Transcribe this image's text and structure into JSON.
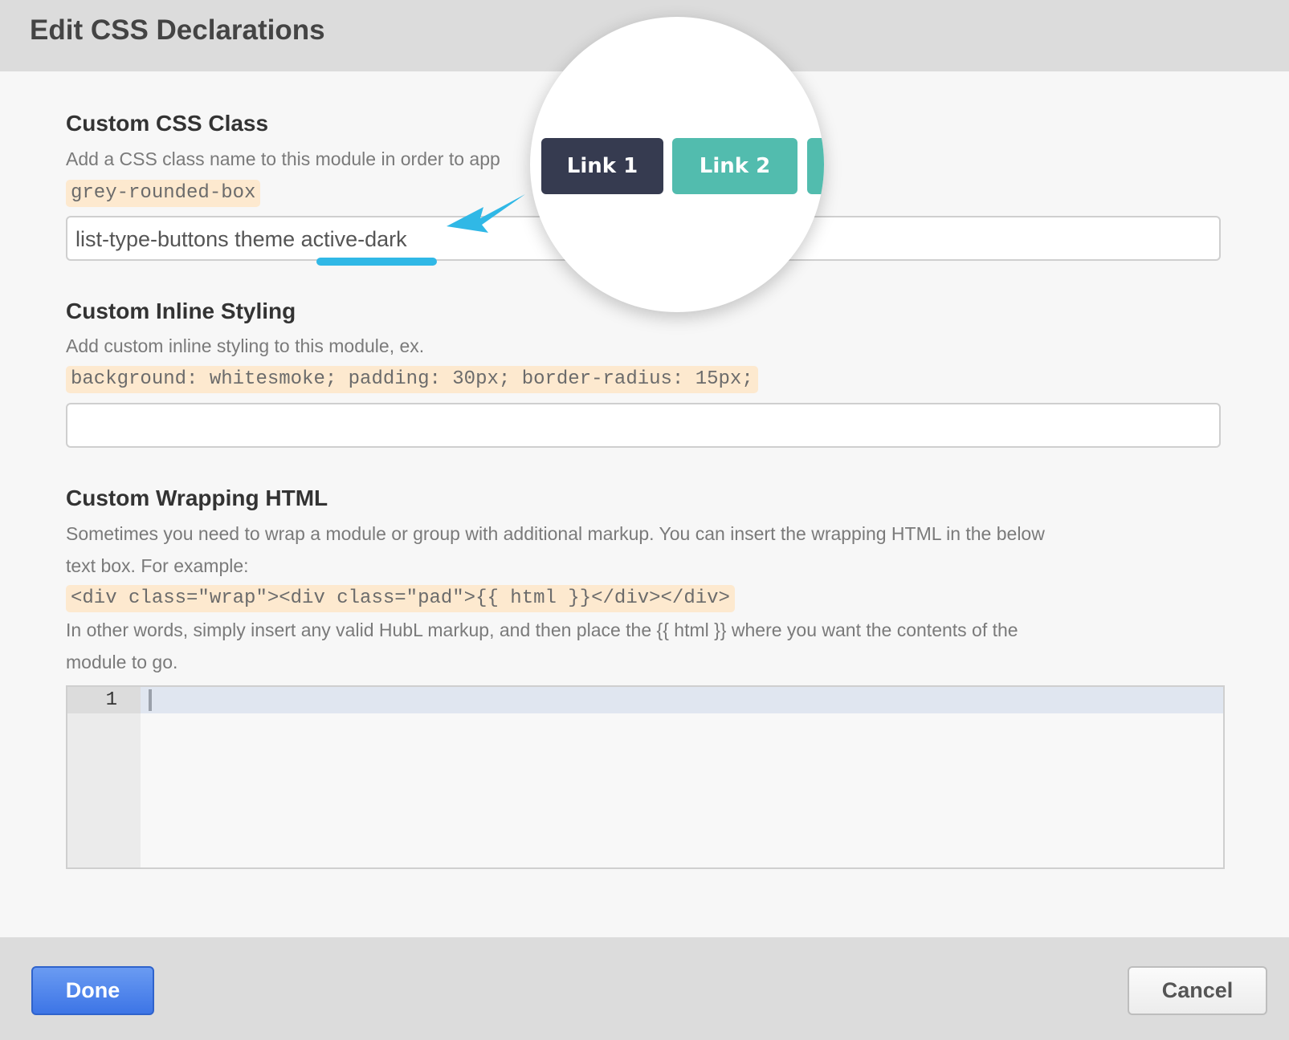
{
  "dialog": {
    "title": "Edit CSS Declarations"
  },
  "css_class": {
    "heading": "Custom CSS Class",
    "description": "Add a CSS class name to this module in order to app",
    "example": "grey-rounded-box",
    "value": "list-type-buttons theme active-dark"
  },
  "inline_styling": {
    "heading": "Custom Inline Styling",
    "description": "Add custom inline styling to this module, ex.",
    "example": "background: whitesmoke; padding: 30px; border-radius: 15px;",
    "value": ""
  },
  "wrapping_html": {
    "heading": "Custom Wrapping HTML",
    "description_line1": "Sometimes you need to wrap a module or group with additional markup. You can insert the wrapping HTML in the below",
    "description_line2": "text box. For example:",
    "example": "<div class=\"wrap\"><div class=\"pad\">{{ html }}</div></div>",
    "note_line1": "In other words, simply insert any valid HubL markup, and then place the {{ html }} where you want the contents of the",
    "note_line2": "module to go.",
    "editor": {
      "line_numbers": [
        "1"
      ],
      "content": ""
    }
  },
  "preview": {
    "buttons": [
      {
        "label": "Link 1",
        "color": "#363b50"
      },
      {
        "label": "Link 2",
        "color": "#52bcae"
      }
    ]
  },
  "footer": {
    "done_label": "Done",
    "cancel_label": "Cancel"
  },
  "colors": {
    "accent_blue": "#3d75e6",
    "highlight": "#30b8e6",
    "code_bg": "#fde9cf"
  }
}
